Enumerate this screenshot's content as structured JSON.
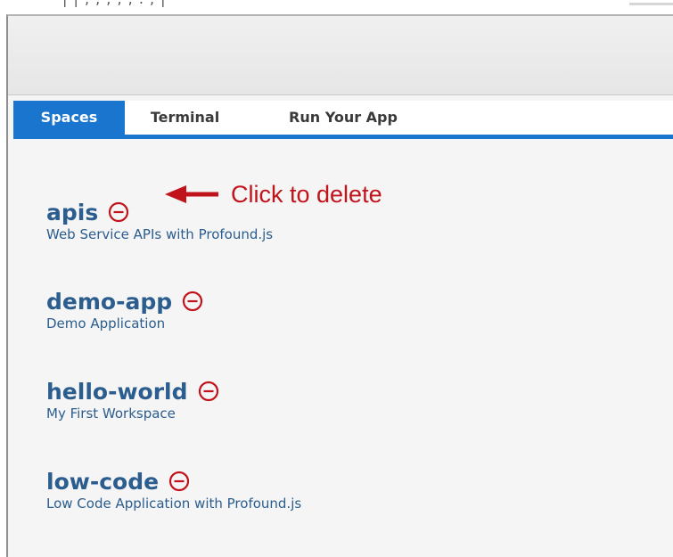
{
  "tabs": [
    {
      "label": "Spaces",
      "active": true
    },
    {
      "label": "Terminal",
      "active": false
    },
    {
      "label": "Run Your App",
      "active": false
    }
  ],
  "spaces": [
    {
      "name": "apis",
      "description": "Web Service APIs with Profound.js"
    },
    {
      "name": "demo-app",
      "description": "Demo Application"
    },
    {
      "name": "hello-world",
      "description": "My First Workspace"
    },
    {
      "name": "low-code",
      "description": "Low Code Application with Profound.js"
    }
  ],
  "annotation": {
    "text": "Click to delete"
  },
  "icons": {
    "delete": "minus-circle-icon",
    "arrow": "left-arrow-icon"
  },
  "colors": {
    "accent_blue": "#1a75cf",
    "link_blue": "#2b5d8e",
    "delete_red": "#c0131b",
    "background": "#f5f5f5"
  }
}
